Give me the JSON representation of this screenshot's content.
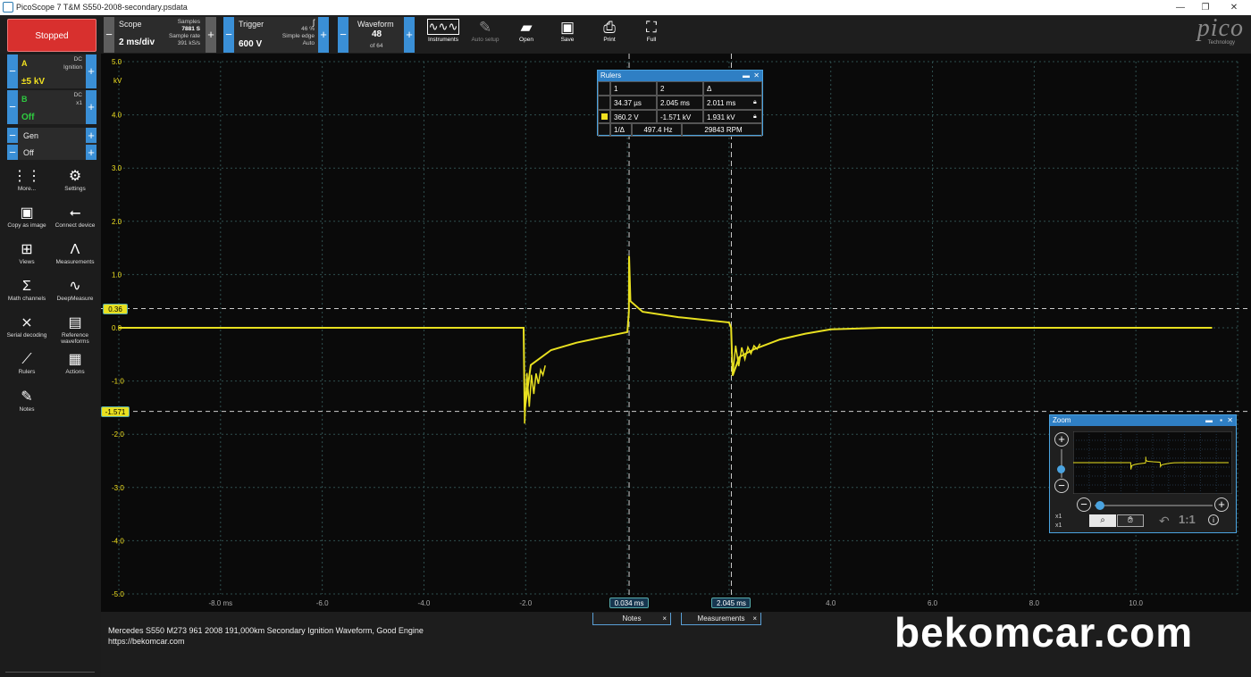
{
  "window": {
    "title": "PicoScope 7 T&M S550-2008-secondary.psdata",
    "min": "—",
    "restore": "❐",
    "close": "✕"
  },
  "toolbar": {
    "run_state": "Stopped",
    "scope": {
      "label": "Scope",
      "timebase": "2 ms/div",
      "samples_label": "Samples",
      "samples": "7881 S",
      "rate_label": "Sample rate",
      "rate": "391 kS/s"
    },
    "trigger": {
      "label": "Trigger",
      "level": "600 V",
      "pct": "46 %",
      "type": "Simple edge",
      "mode": "Auto",
      "edge_icon": "rising-edge-icon"
    },
    "waveform": {
      "label": "Waveform",
      "current": "48",
      "total": "of 64"
    },
    "buttons": [
      {
        "label": "Instruments",
        "icon": "instruments-icon"
      },
      {
        "label": "Auto setup",
        "icon": "wand-icon"
      },
      {
        "label": "Open",
        "icon": "folder-icon"
      },
      {
        "label": "Save",
        "icon": "save-icon"
      },
      {
        "label": "Print",
        "icon": "print-icon"
      },
      {
        "label": "Full",
        "icon": "fullscreen-icon"
      }
    ],
    "logo": "pico",
    "logo_sub": "Technology"
  },
  "channels": [
    {
      "name": "A",
      "coupling": "DC",
      "probe": "Ignition",
      "range": "±5 kV",
      "color": "#f0e020"
    },
    {
      "name": "B",
      "coupling": "DC",
      "probe": "x1",
      "range": "Off",
      "color": "#2ecc40"
    }
  ],
  "generator": {
    "label": "Gen",
    "state": "Off"
  },
  "side_tools": [
    {
      "label": "More...",
      "icon": "grid-icon",
      "glyph": "⋮⋮"
    },
    {
      "label": "Settings",
      "icon": "gear-icon",
      "glyph": "⚙"
    },
    {
      "label": "Copy as image",
      "icon": "image-icon",
      "glyph": "▣"
    },
    {
      "label": "Connect device",
      "icon": "usb-icon",
      "glyph": "⭠"
    },
    {
      "label": "Views",
      "icon": "views-icon",
      "glyph": "⊞"
    },
    {
      "label": "Measurements",
      "icon": "measure-icon",
      "glyph": "Λ"
    },
    {
      "label": "Math channels",
      "icon": "sigma-icon",
      "glyph": "Σ"
    },
    {
      "label": "DeepMeasure",
      "icon": "deepmeasure-icon",
      "glyph": "∿"
    },
    {
      "label": "Serial decoding",
      "icon": "serial-icon",
      "glyph": "⨯"
    },
    {
      "label": "Reference waveforms",
      "icon": "reference-icon",
      "glyph": "▤"
    },
    {
      "label": "Rulers",
      "icon": "ruler-icon",
      "glyph": "⟋"
    },
    {
      "label": "Actions",
      "icon": "actions-icon",
      "glyph": "▦"
    },
    {
      "label": "Notes",
      "icon": "notes-icon",
      "glyph": "✎"
    }
  ],
  "chart_data": {
    "type": "line",
    "y_unit": "kV",
    "y_ticks": [
      "5.0",
      "4.0",
      "3.0",
      "2.0",
      "1.0",
      "0.0",
      "-1.0",
      "-2.0",
      "-3.0",
      "-4.0",
      "-5.0"
    ],
    "x_ticks": [
      "-8.0 ms",
      "-6.0",
      "-4.0",
      "-2.0",
      "0.0",
      "2.0",
      "4.0",
      "6.0",
      "8.0",
      "10.0"
    ],
    "xlim": [
      -10,
      12
    ],
    "ylim": [
      -5,
      5
    ],
    "series": [
      {
        "color": "#e8e020",
        "points": [
          [
            -10,
            0
          ],
          [
            -2.04,
            0
          ],
          [
            -2.02,
            -1.55
          ],
          [
            -1.9,
            -0.7
          ],
          [
            -1.5,
            -0.42
          ],
          [
            -1.0,
            -0.28
          ],
          [
            -0.5,
            -0.18
          ],
          [
            0.0,
            -0.08
          ],
          [
            0.03,
            0.3
          ],
          [
            0.034,
            1.35
          ],
          [
            0.06,
            0.5
          ],
          [
            0.3,
            0.3
          ],
          [
            1.0,
            0.2
          ],
          [
            2.0,
            0.1
          ],
          [
            2.04,
            0.0
          ],
          [
            2.07,
            -0.9
          ],
          [
            2.2,
            -0.55
          ],
          [
            2.5,
            -0.4
          ],
          [
            3.0,
            -0.22
          ],
          [
            3.5,
            -0.11
          ],
          [
            4.0,
            -0.03
          ],
          [
            5.0,
            0
          ],
          [
            11.5,
            0
          ]
        ]
      }
    ]
  },
  "ruler_badges": {
    "h1": "0.36",
    "h2": "-1.571",
    "v1": "0.034 ms",
    "v2": "2.045 ms"
  },
  "rulers_panel": {
    "title": "Rulers",
    "c1": "1",
    "c2": "2",
    "c3": "Δ",
    "t1": "34.37 µs",
    "t2": "2.045 ms",
    "td": "2.011 ms",
    "v1": "360.2 V",
    "v2": "-1.571 kV",
    "vd": "1.931 kV",
    "inv": "1/Δ",
    "freq": "497.4 Hz",
    "rpm": "29843 RPM"
  },
  "zoom_panel": {
    "title": "Zoom",
    "x1": "x1",
    "x2": "x1",
    "reset": "1:1"
  },
  "notes": {
    "tab_notes": "Notes",
    "tab_measurements": "Measurements",
    "line1": "Mercedes S550 M273 961 2008 191,000km Secondary Ignition Waveform, Good Engine",
    "line2": "https://bekomcar.com"
  },
  "watermark": "bekomcar.com"
}
